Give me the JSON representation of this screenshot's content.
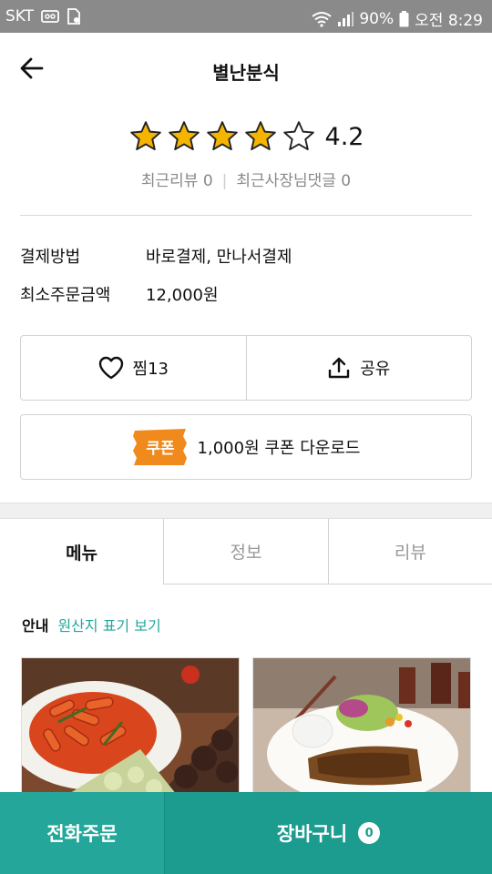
{
  "status_bar": {
    "carrier": "SKT",
    "battery": "90%",
    "time": "오전 8:29",
    "icons": [
      "voicemail-icon",
      "sim-icon",
      "wifi-icon",
      "signal-icon",
      "battery-icon"
    ]
  },
  "header": {
    "title": "별난분식",
    "back_icon": "back-arrow-icon"
  },
  "rating": {
    "value": "4.2",
    "stars_filled": 4,
    "stars_total": 5,
    "star_color": "#f5b400"
  },
  "reviews": {
    "recent_review": "최근리뷰 0",
    "owner_reply": "최근사장님댓글 0"
  },
  "info": {
    "payment_label": "결제방법",
    "payment_value": "바로결제, 만나서결제",
    "min_order_label": "최소주문금액",
    "min_order_value": "12,000원"
  },
  "actions": {
    "like_label": "찜13",
    "share_label": "공유"
  },
  "coupon": {
    "tag": "쿠폰",
    "text": "1,000원 쿠폰 다운로드",
    "tag_color": "#f08a1c"
  },
  "tabs": [
    {
      "label": "메뉴",
      "active": true
    },
    {
      "label": "정보",
      "active": false
    },
    {
      "label": "리뷰",
      "active": false
    }
  ],
  "notice": {
    "label": "안내",
    "link": "원산지 표기 보기"
  },
  "bottom": {
    "phone_order": "전화주문",
    "cart": "장바구니",
    "cart_count": "0"
  },
  "colors": {
    "accent": "#24a79a",
    "accent_dark": "#1c9b8f"
  }
}
